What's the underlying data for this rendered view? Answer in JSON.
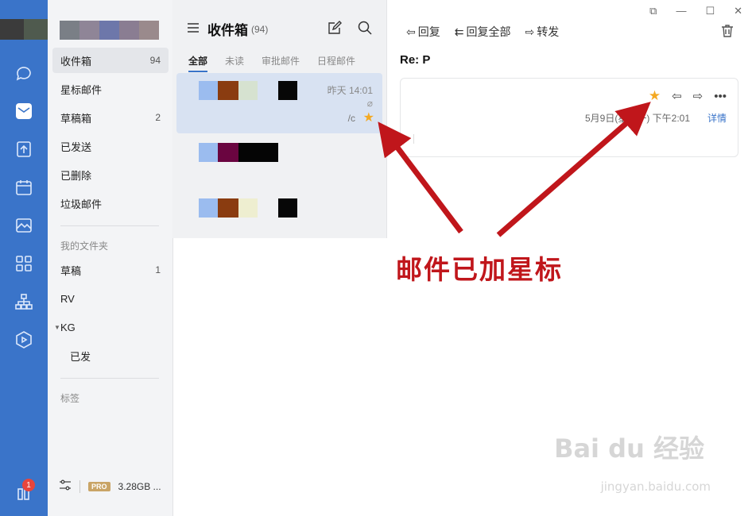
{
  "rail": {
    "icons": [
      "chat-icon",
      "mail-icon",
      "doc-icon",
      "calendar-icon",
      "drive-icon",
      "apps-icon",
      "org-icon",
      "meeting-icon",
      "contacts-icon"
    ],
    "badge": "1",
    "accent": "#3a74c9"
  },
  "folders": {
    "items": [
      {
        "label": "收件箱",
        "count": "94"
      },
      {
        "label": "星标邮件",
        "count": ""
      },
      {
        "label": "草稿箱",
        "count": "2"
      },
      {
        "label": "已发送",
        "count": ""
      },
      {
        "label": "已删除",
        "count": ""
      },
      {
        "label": "垃圾邮件",
        "count": ""
      }
    ],
    "my_folders_header": "我的文件夹",
    "my_folders": [
      {
        "label": "草稿",
        "count": "1"
      },
      {
        "label": "RV",
        "count": ""
      },
      {
        "label": "KG",
        "count": ""
      },
      {
        "label": "已发",
        "count": ""
      }
    ],
    "tags_header": "标签",
    "storage": "3.28GB ...",
    "pro_label": "PRO"
  },
  "list": {
    "title": "收件箱",
    "count": "(94)",
    "tabs": [
      "全部",
      "未读",
      "审批邮件",
      "日程邮件"
    ],
    "rows": [
      {
        "time": "昨天 14:01",
        "fragment": "/c",
        "starred": true
      },
      {
        "time": "",
        "fragment": "",
        "starred": false
      },
      {
        "time": "",
        "fragment": "",
        "starred": false
      }
    ]
  },
  "reader": {
    "toolbar": {
      "reply": "回复",
      "reply_all": "回复全部",
      "forward": "转发"
    },
    "subject": "Re: P",
    "date": "5月9日(星期一) 下午2:01",
    "detail": "详情"
  },
  "annotation": "邮件已加星标",
  "watermark": {
    "logo": "Bai du 经验",
    "url": "jingyan.baidu.com"
  },
  "colors": {
    "star": "#f4a922",
    "annotation": "#c0161b"
  }
}
